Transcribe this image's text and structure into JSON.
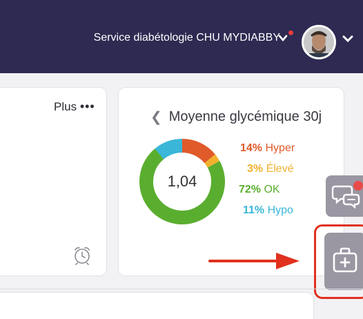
{
  "header": {
    "service_name": "Service diabétologie CHU MYDIABBY",
    "service_chevron_icon": "chevron-down-icon",
    "user_menu_icon": "chevron-down-icon",
    "background_color": "#2e2a52"
  },
  "left_card": {
    "plus_label": "Plus",
    "more_icon_text": "•••",
    "alarm_icon": "alarm-clock-icon"
  },
  "glycemia_card": {
    "title": "Moyenne glycémique 30j",
    "back_icon_text": "❮",
    "center_value": "1,04",
    "legend": [
      {
        "percent": "14%",
        "label": "Hyper",
        "value": 14,
        "color": "#e05a2a"
      },
      {
        "percent": "3%",
        "label": "Élevé",
        "value": 3,
        "color": "#f2b12f"
      },
      {
        "percent": "72%",
        "label": "OK",
        "value": 72,
        "color": "#5aae2f"
      },
      {
        "percent": "11%",
        "label": "Hypo",
        "value": 11,
        "color": "#39b6d8"
      }
    ]
  },
  "side_actions": {
    "chat_icon": "chat-bubbles-icon",
    "kit_icon": "medical-kit-icon",
    "highlight_color": "#e0311e"
  },
  "chart_data": {
    "type": "pie",
    "categories": [
      "Hyper",
      "Élevé",
      "OK",
      "Hypo"
    ],
    "values": [
      14,
      3,
      72,
      11
    ],
    "title": "Moyenne glycémique 30j",
    "center_label": "1,04"
  }
}
